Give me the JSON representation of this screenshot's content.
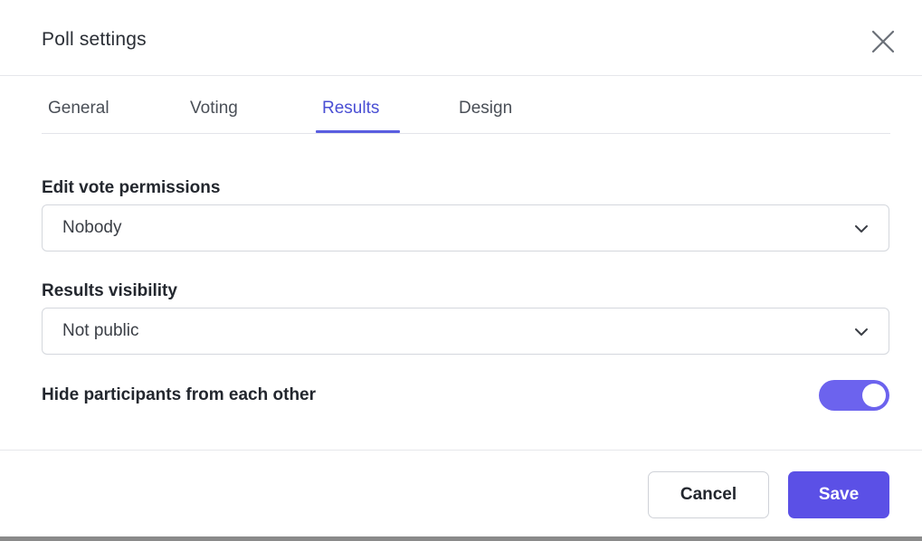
{
  "dialog": {
    "title": "Poll settings"
  },
  "tabs": [
    {
      "label": "General",
      "active": false
    },
    {
      "label": "Voting",
      "active": false
    },
    {
      "label": "Results",
      "active": true
    },
    {
      "label": "Design",
      "active": false
    }
  ],
  "fields": {
    "edit_vote_permissions": {
      "label": "Edit vote permissions",
      "value": "Nobody"
    },
    "results_visibility": {
      "label": "Results visibility",
      "value": "Not public"
    },
    "hide_participants": {
      "label": "Hide participants from each other",
      "enabled": true
    }
  },
  "footer": {
    "cancel_label": "Cancel",
    "save_label": "Save"
  },
  "colors": {
    "accent": "#5b50e6",
    "active_tab": "#4a4fd4",
    "toggle_on": "#6c63ee"
  },
  "icons": {
    "close": "close-icon",
    "dropdown": "chevron-down-icon"
  }
}
